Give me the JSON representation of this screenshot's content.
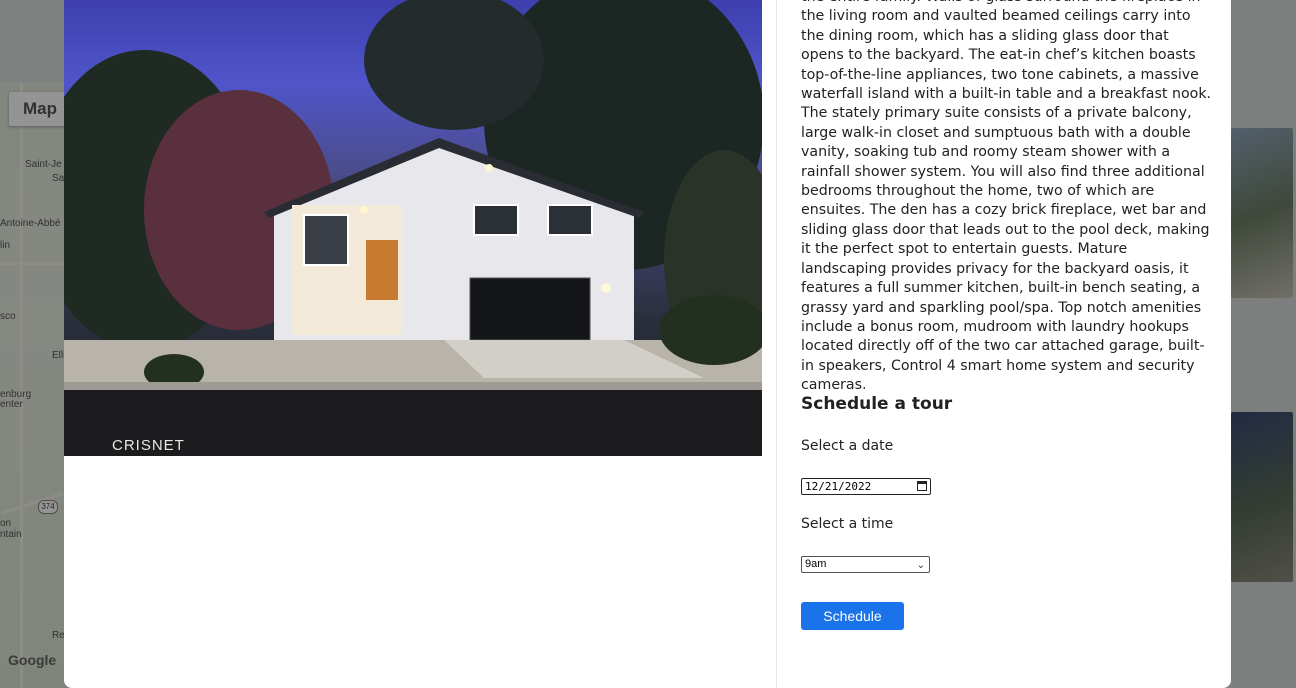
{
  "background": {
    "map_button": "Map",
    "map_labels": [
      "Saint-Je",
      "Sa",
      "Antoine-Abbé",
      "lin",
      "sco",
      "Elli",
      "enburg",
      "enter",
      "on",
      "ntain",
      "Re"
    ],
    "route_shield": "374",
    "google_logo": "Google"
  },
  "modal": {
    "photo": {
      "watermark": "CRISNET"
    },
    "description": "the entire family. Walls of glass surround the fireplace in the living room and vaulted beamed ceilings carry into the dining room, which has a sliding glass door that opens to the backyard. The eat-in chef’s kitchen boasts top-of-the-line appliances, two tone cabinets, a massive waterfall island with a built-in table and a breakfast nook. The stately primary suite consists of a private balcony, large walk-in closet and sumptuous bath with a double vanity, soaking tub and roomy steam shower with a rainfall shower system. You will also find three additional bedrooms throughout the home, two of which are ensuites. The den has a cozy brick fireplace, wet bar and sliding glass door that leads out to the pool deck, making it the perfect spot to entertain guests. Mature landscaping provides privacy for the backyard oasis, it features a full summer kitchen, built-in bench seating, a grassy yard and sparkling pool/spa. Top notch amenities include a bonus room, mudroom with laundry hookups located directly off of the two car attached garage, built-in speakers, Control 4 smart home system and security cameras.",
    "tour": {
      "title": "Schedule a tour",
      "date_label": "Select a date",
      "date_value": "12/21/2022",
      "time_label": "Select a time",
      "time_value": "9am",
      "schedule_button": "Schedule"
    }
  }
}
